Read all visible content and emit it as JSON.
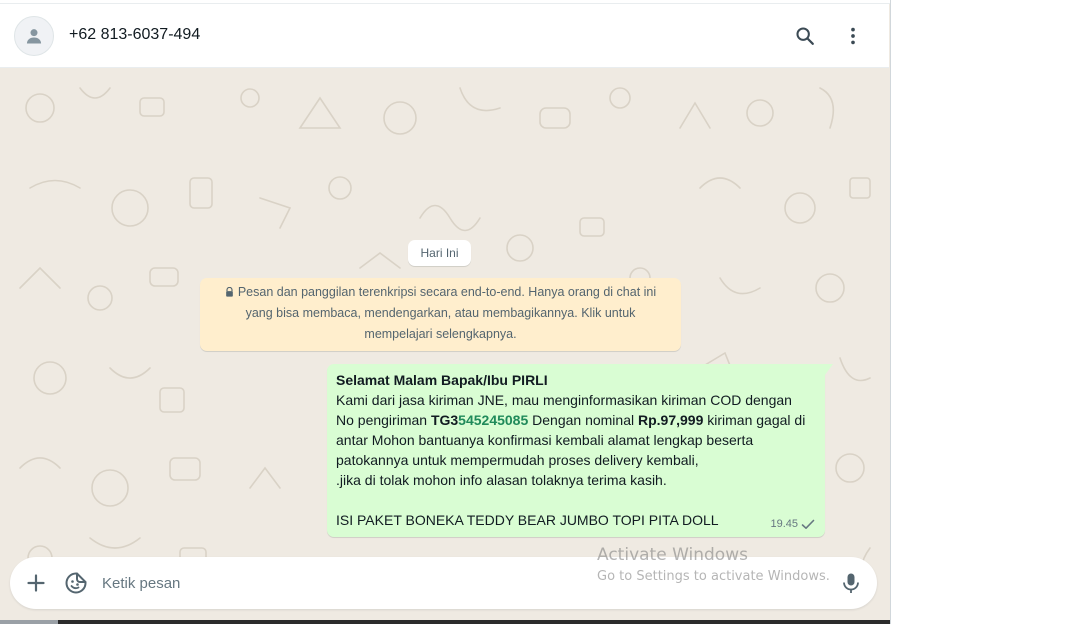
{
  "header": {
    "contact_name": "+62 813-6037-494",
    "avatar_icon": "default-user-icon",
    "search_icon": "search-icon",
    "menu_icon": "more-vertical-icon"
  },
  "chat": {
    "date_chip": "Hari Ini",
    "encryption_notice": "Pesan dan panggilan terenkripsi secara end-to-end. Hanya orang di chat ini yang bisa membaca, mendengarkan, atau membagikannya. Klik untuk mempelajari selengkapnya.",
    "encryption_lines": [
      "Pesan dan panggilan terenkripsi secara end-to-end. Hanya orang di chat ini",
      "yang bisa membaca, mendengarkan, atau membagikannya. Klik untuk",
      "mempelajari selengkapnya."
    ],
    "message": {
      "greeting": "Selamat Malam Bapak/Ibu PIRLI",
      "line1": "Kami dari jasa kiriman JNE, mau menginformasikan kiriman COD dengan",
      "line2_prefix": "No pengiriman ",
      "tracking_prefix": "TG3",
      "tracking_number": "545245085",
      "line2_mid": " Dengan nominal ",
      "amount": "Rp.97,999",
      "line2_suffix": " kiriman gagal di",
      "line3": "antar Mohon bantuanya konfirmasi kembali alamat lengkap beserta",
      "line4": "patokannya untuk mempermudah proses delivery kembali,",
      "line5": " .jika di tolak mohon info alasan tolaknya terima kasih.",
      "line6": "ISI PAKET BONEKA TEDDY BEAR JUMBO TOPI PITA DOLL",
      "time": "19.45",
      "status_icon": "single-check-icon"
    }
  },
  "composer": {
    "placeholder": "Ketik pesan",
    "value": "",
    "attach_icon": "plus-icon",
    "sticker_icon": "sticker-icon",
    "mic_icon": "microphone-icon"
  },
  "watermark": {
    "title": "Activate Windows",
    "subtitle": "Go to Settings to activate Windows."
  },
  "colors": {
    "chat_background": "#efeae2",
    "outgoing_bubble": "#d9fdd3",
    "notice_background": "#ffeecd",
    "tracking_number": "#1f8a5a"
  }
}
